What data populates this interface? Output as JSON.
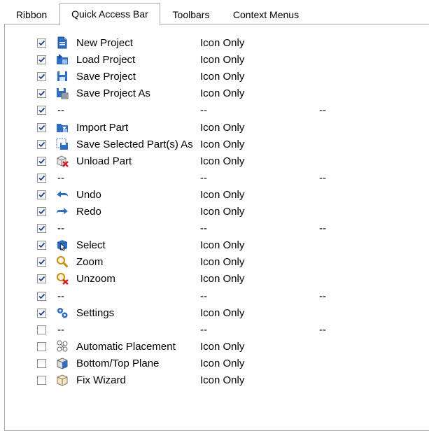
{
  "tabs": [
    {
      "label": "Ribbon",
      "active": false
    },
    {
      "label": "Quick Access Bar",
      "active": true
    },
    {
      "label": "Toolbars",
      "active": false
    },
    {
      "label": "Context Menus",
      "active": false
    }
  ],
  "items": [
    {
      "checked": true,
      "icon": "new-project-icon",
      "name": "New Project",
      "mode": "Icon Only",
      "extra": ""
    },
    {
      "checked": true,
      "icon": "load-project-icon",
      "name": "Load Project",
      "mode": "Icon Only",
      "extra": ""
    },
    {
      "checked": true,
      "icon": "save-project-icon",
      "name": "Save Project",
      "mode": "Icon Only",
      "extra": ""
    },
    {
      "checked": true,
      "icon": "save-project-as-icon",
      "name": "Save Project As",
      "mode": "Icon Only",
      "extra": ""
    },
    {
      "checked": true,
      "icon": "",
      "name": "--",
      "mode": "--",
      "extra": "--"
    },
    {
      "checked": true,
      "icon": "import-part-icon",
      "name": "Import Part",
      "mode": "Icon Only",
      "extra": ""
    },
    {
      "checked": true,
      "icon": "save-selected-part-icon",
      "name": "Save Selected Part(s) As",
      "mode": "Icon Only",
      "extra": ""
    },
    {
      "checked": true,
      "icon": "unload-part-icon",
      "name": "Unload Part",
      "mode": "Icon Only",
      "extra": ""
    },
    {
      "checked": true,
      "icon": "",
      "name": "--",
      "mode": "--",
      "extra": "--"
    },
    {
      "checked": true,
      "icon": "undo-icon",
      "name": "Undo",
      "mode": "Icon Only",
      "extra": ""
    },
    {
      "checked": true,
      "icon": "redo-icon",
      "name": "Redo",
      "mode": "Icon Only",
      "extra": ""
    },
    {
      "checked": true,
      "icon": "",
      "name": "--",
      "mode": "--",
      "extra": "--"
    },
    {
      "checked": true,
      "icon": "select-icon",
      "name": "Select",
      "mode": "Icon Only",
      "extra": ""
    },
    {
      "checked": true,
      "icon": "zoom-icon",
      "name": "Zoom",
      "mode": "Icon Only",
      "extra": ""
    },
    {
      "checked": true,
      "icon": "unzoom-icon",
      "name": "Unzoom",
      "mode": "Icon Only",
      "extra": ""
    },
    {
      "checked": true,
      "icon": "",
      "name": "--",
      "mode": "--",
      "extra": "--"
    },
    {
      "checked": true,
      "icon": "settings-icon",
      "name": "Settings",
      "mode": "Icon Only",
      "extra": ""
    },
    {
      "checked": false,
      "icon": "",
      "name": "--",
      "mode": "--",
      "extra": "--"
    },
    {
      "checked": false,
      "icon": "automatic-placement-icon",
      "name": "Automatic Placement",
      "mode": "Icon Only",
      "extra": ""
    },
    {
      "checked": false,
      "icon": "bottom-top-plane-icon",
      "name": "Bottom/Top Plane",
      "mode": "Icon Only",
      "extra": ""
    },
    {
      "checked": false,
      "icon": "fix-wizard-icon",
      "name": "Fix Wizard",
      "mode": "Icon Only",
      "extra": ""
    }
  ],
  "colors": {
    "checkmark": "#1f3f8a",
    "icon_blue": "#2e6fc4",
    "icon_red": "#d02020",
    "border": "#a9a9a9"
  }
}
